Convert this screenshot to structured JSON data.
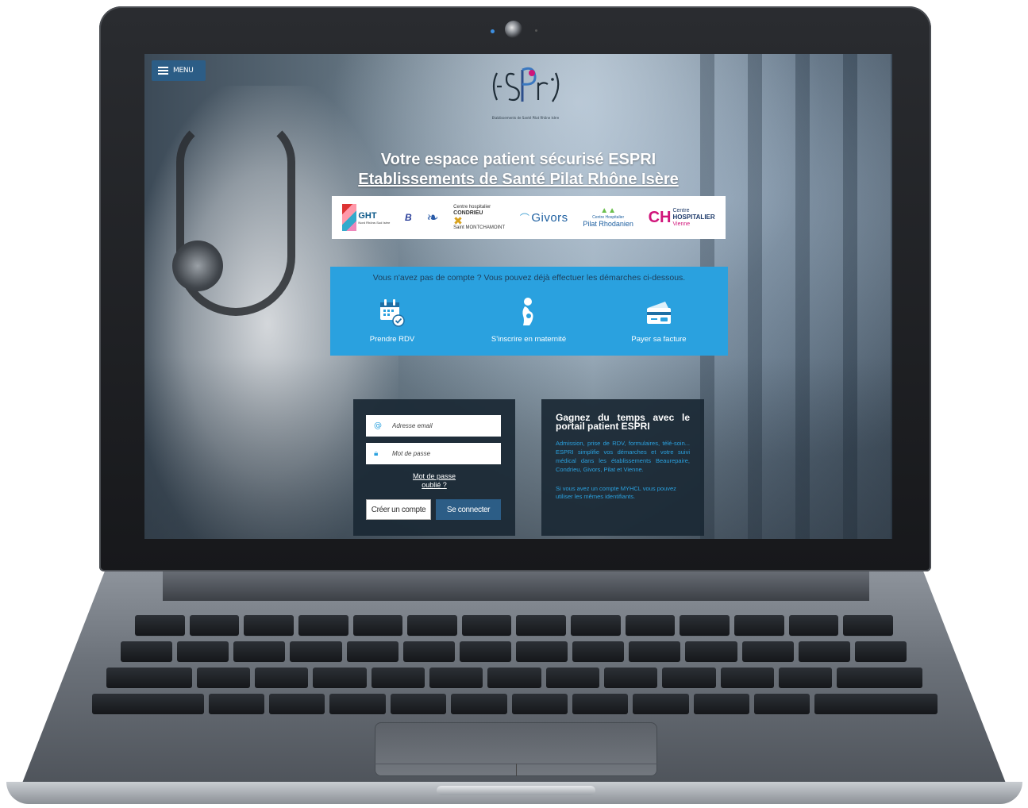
{
  "menu": {
    "label": "MENU"
  },
  "logo": {
    "text": "ESPRI",
    "tagline": "Etablissements de Santé Pilat Rhône Isère"
  },
  "header": {
    "title_line1": "Votre espace patient sécurisé ESPRI",
    "title_line2": "Etablissements de Santé Pilat Rhône Isère"
  },
  "partners": {
    "ght": {
      "name": "GHT",
      "sub": "Nord Rhône-Sud Isère"
    },
    "beaurepaire": "B",
    "condrieu": {
      "top": "Centre hospitalier",
      "name": "CONDRIEU",
      "sub": "Saint MONTCHAMOINT"
    },
    "givors": "Givors",
    "pilat": {
      "top": "Centre Hospitalier",
      "name": "Pilat Rhodanien"
    },
    "vienne": {
      "mark": "CH",
      "line1": "Centre",
      "line2": "HOSPITALIER",
      "line3": "Vienne"
    }
  },
  "actions": {
    "title": "Vous n'avez pas de compte ? Vous pouvez déjà effectuer les démarches ci-dessous.",
    "items": [
      {
        "label": "Prendre RDV",
        "icon": "calendar-check-icon"
      },
      {
        "label": "S'inscrire en maternité",
        "icon": "pregnant-icon"
      },
      {
        "label": "Payer sa facture",
        "icon": "credit-card-icon"
      }
    ]
  },
  "login": {
    "email_placeholder": "Adresse email",
    "password_placeholder": "Mot de passe",
    "forgot_line1": "Mot de passe",
    "forgot_line2": "oublié ?",
    "create_label": "Créer un compte",
    "login_label": "Se connecter"
  },
  "info": {
    "title": "Gagnez du temps avec le portail patient ESPRI",
    "text": "Admission, prise de RDV, formulaires, télé-soin... ESPRI simplifie vos démarches et votre suivi médical dans les établissements Beaurepaire, Condrieu, Givors, Pilat et Vienne.",
    "text2": "Si vous avez un compte MYHCL vous pouvez utiliser les mêmes identifiants."
  },
  "colors": {
    "accent": "#2aa1df",
    "dark_panel": "#1a2834",
    "button": "#2c5d86"
  }
}
